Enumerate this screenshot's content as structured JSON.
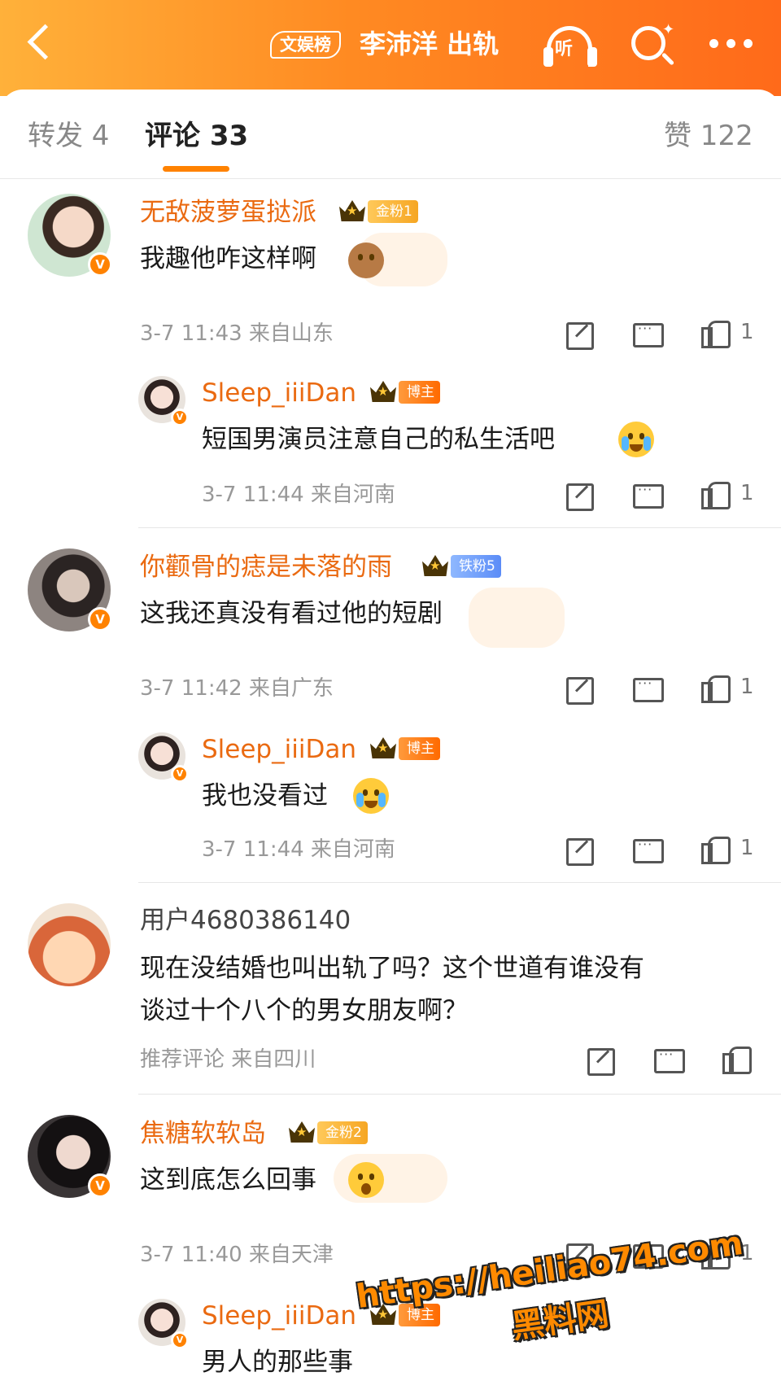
{
  "header": {
    "tag": "文娱榜",
    "title": "李沛洋 出轨",
    "listen_label": "听"
  },
  "tabs": {
    "repost": "转发 4",
    "comment": "评论 33",
    "like": "赞 122"
  },
  "comments": [
    {
      "user": "无敌菠萝蛋挞派",
      "fan_badge": "金粉1",
      "text": "我趣他咋这样啊",
      "time_location": "3-7 11:43 来自山东",
      "likes": "1",
      "reply": {
        "user": "Sleep_iiiDan",
        "badge": "博主",
        "text": "短国男演员注意自己的私生活吧",
        "time_location": "3-7 11:44 来自河南",
        "likes": "1"
      }
    },
    {
      "user": "你颧骨的痣是未落的雨",
      "fan_badge": "铁粉5",
      "text": "这我还真没有看过他的短剧",
      "time_location": "3-7 11:42 来自广东",
      "likes": "1",
      "reply": {
        "user": "Sleep_iiiDan",
        "badge": "博主",
        "text": "我也没看过",
        "time_location": "3-7 11:44 来自河南",
        "likes": "1"
      }
    },
    {
      "user": "用户4680386140",
      "text_line1": "现在没结婚也叫出轨了吗？这个世道有谁没有",
      "text_line2": "谈过十个八个的男女朋友啊？",
      "meta": "推荐评论 来自四川"
    },
    {
      "user": "焦糖软软岛",
      "fan_badge": "金粉2",
      "text": "这到底怎么回事",
      "time_location": "3-7 11:40 来自天津",
      "likes": "1",
      "reply": {
        "user": "Sleep_iiiDan",
        "badge": "博主",
        "text": "男人的那些事"
      }
    }
  ],
  "watermark": {
    "url": "https://heiliao74.com",
    "name": "黑料网"
  },
  "colors": {
    "accent": "#ff8200",
    "username": "#ea6a11"
  }
}
